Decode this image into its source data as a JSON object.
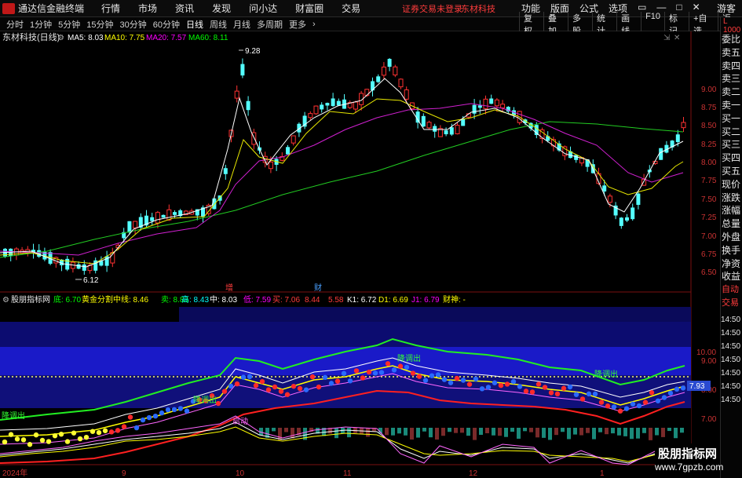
{
  "menubar": {
    "app_name": "通达信金融终端",
    "items": [
      "行情",
      "市场",
      "资讯",
      "发现",
      "问小达",
      "财富圈",
      "交易"
    ],
    "warning": "证券交易未登录",
    "stock_name": "东材科技",
    "right_items": [
      "功能",
      "版面",
      "公式",
      "选项"
    ],
    "guest": "游客"
  },
  "toolbar": {
    "periods": [
      "分时",
      "1分钟",
      "5分钟",
      "15分钟",
      "30分钟",
      "60分钟",
      "日线",
      "周线",
      "月线",
      "多周期",
      "更多"
    ],
    "active_period": "日线",
    "tools": [
      "复权",
      "叠加",
      "多股",
      "统计",
      "画线",
      "F10",
      "标记",
      "+自选",
      "返回"
    ]
  },
  "main_chart": {
    "title": "东材科技(日线)",
    "ma_labels": [
      {
        "text": "MA5: 8.03",
        "color": "#ffffff"
      },
      {
        "text": "MA10: 7.75",
        "color": "#ffff00"
      },
      {
        "text": "MA20: 7.57",
        "color": "#ff00ff"
      },
      {
        "text": "MA60: 8.11",
        "color": "#00ff00"
      }
    ],
    "high_label": "9.28",
    "low_label": "6.12",
    "markers": [
      "增",
      "财"
    ],
    "y_ticks": [
      "9.00",
      "8.75",
      "8.50",
      "8.25",
      "8.00",
      "7.75",
      "7.50",
      "7.25",
      "7.00",
      "6.75",
      "6.50"
    ]
  },
  "sub_chart": {
    "title": "股朋指标网",
    "labels": [
      {
        "text": "底: 6.70",
        "color": "#00ff00"
      },
      {
        "text": "黄金分割中线: 8.46",
        "color": "#ffff00"
      },
      {
        "text": "卖: 8.83",
        "color": "#00ff00"
      },
      {
        "text": "高: 8.43",
        "color": "#00ffff"
      },
      {
        "text": "中: 8.03",
        "color": "#ffffff"
      },
      {
        "text": "低: 7.59",
        "color": "#ff00ff"
      },
      {
        "text": "买: 7.06",
        "color": "#ff3c3c"
      },
      {
        "text": "8.44",
        "color": "#ff3c3c"
      },
      {
        "text": "5.58",
        "color": "#ff3c3c"
      },
      {
        "text": "K1: 6.72",
        "color": "#ffffff"
      },
      {
        "text": "D1: 6.69",
        "color": "#ffff00"
      },
      {
        "text": "J1: 6.79",
        "color": "#ff00ff"
      },
      {
        "text": "财神: -",
        "color": "#ffff00"
      }
    ],
    "annotations": [
      "降调出",
      "降调出",
      "降调出",
      "降调出",
      "启动"
    ],
    "price_box": "7.93",
    "y_ticks": [
      "10.00",
      "9.00",
      "8.00",
      "7.00"
    ],
    "right_ticks": [
      "14:50",
      "14:50",
      "14:50",
      "14:50",
      "14:50",
      "14:50",
      "14:50",
      "14:50"
    ]
  },
  "x_axis": {
    "labels": [
      "2024年",
      "9",
      "10",
      "11",
      "12",
      "1"
    ]
  },
  "sidebar": {
    "header": "L 1000",
    "tabs": [
      "委比",
      "卖五",
      "卖四",
      "卖三",
      "卖二",
      "卖一",
      "买一",
      "买二",
      "买三",
      "买四",
      "买五",
      "现价",
      "涨跌",
      "涨幅",
      "总量",
      "外盘",
      "换手",
      "净资",
      "收益"
    ],
    "tabs2": [
      "自动",
      "交易"
    ]
  },
  "watermark": {
    "line1": "股朋指标网",
    "line2": "www.7gpzb.com"
  },
  "colors": {
    "up": "#ff3232",
    "down": "#54ffff",
    "ma5": "#ffffff",
    "ma10": "#ffff00",
    "ma20": "#ff00ff",
    "ma60": "#00ff00",
    "subpanel_bg": "#10107a"
  }
}
